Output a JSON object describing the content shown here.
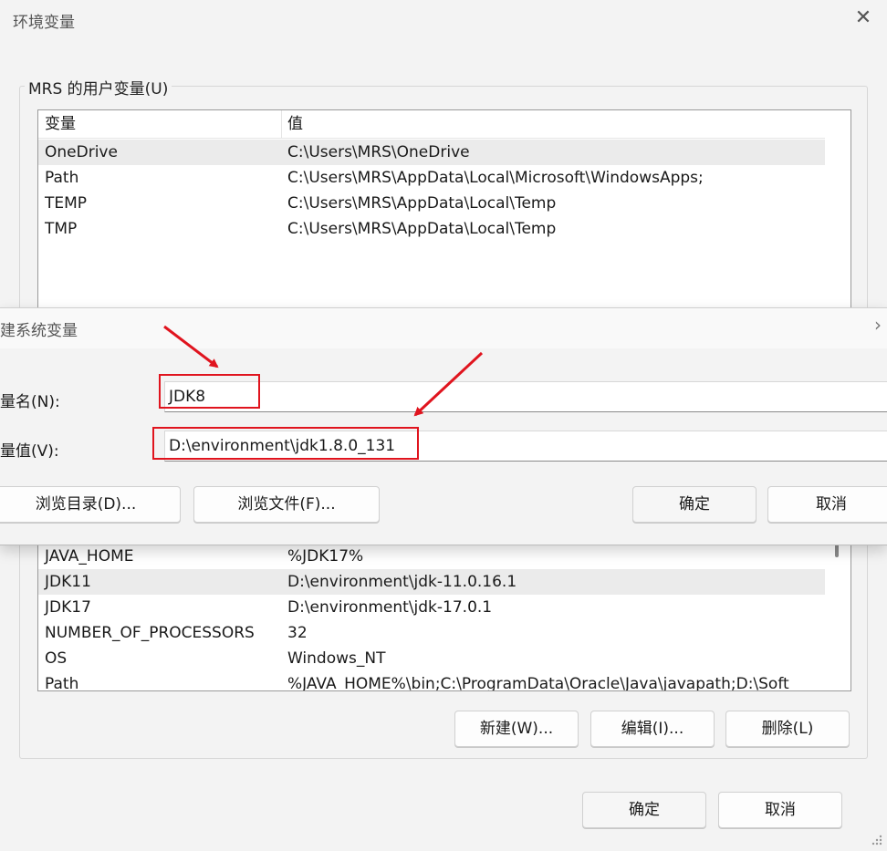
{
  "window": {
    "title": "环境变量",
    "close_icon": "close-icon"
  },
  "user_vars": {
    "legend": "MRS 的用户变量(U)",
    "headers": {
      "name": "变量",
      "value": "值"
    },
    "rows": [
      {
        "name": "OneDrive",
        "value": "C:\\Users\\MRS\\OneDrive"
      },
      {
        "name": "Path",
        "value": "C:\\Users\\MRS\\AppData\\Local\\Microsoft\\WindowsApps;"
      },
      {
        "name": "TEMP",
        "value": "C:\\Users\\MRS\\AppData\\Local\\Temp"
      },
      {
        "name": "TMP",
        "value": "C:\\Users\\MRS\\AppData\\Local\\Temp"
      }
    ]
  },
  "system_vars": {
    "rows": [
      {
        "name": "JAVA_HOME",
        "value": "%JDK17%"
      },
      {
        "name": "JDK11",
        "value": "D:\\environment\\jdk-11.0.16.1"
      },
      {
        "name": "JDK17",
        "value": "D:\\environment\\jdk-17.0.1"
      },
      {
        "name": "NUMBER_OF_PROCESSORS",
        "value": "32"
      },
      {
        "name": "OS",
        "value": "Windows_NT"
      },
      {
        "name": "Path",
        "value": "%JAVA_HOME%\\bin;C:\\ProgramData\\Oracle\\Java\\javapath;D:\\Soft"
      }
    ],
    "buttons": {
      "new": "新建(W)...",
      "edit": "编辑(I)...",
      "delete": "删除(L)"
    }
  },
  "footer": {
    "ok": "确定",
    "cancel": "取消"
  },
  "new_var_dialog": {
    "title": "新建系统变量",
    "name_label": "变量名(N):",
    "name_value": "JDK8",
    "value_label": "变量值(V):",
    "value_value": "D:\\environment\\jdk1.8.0_131",
    "browse_dir": "浏览目录(D)...",
    "browse_file": "浏览文件(F)...",
    "ok": "确定",
    "cancel": "取消"
  },
  "annotations": {
    "color": "#e0141e"
  }
}
